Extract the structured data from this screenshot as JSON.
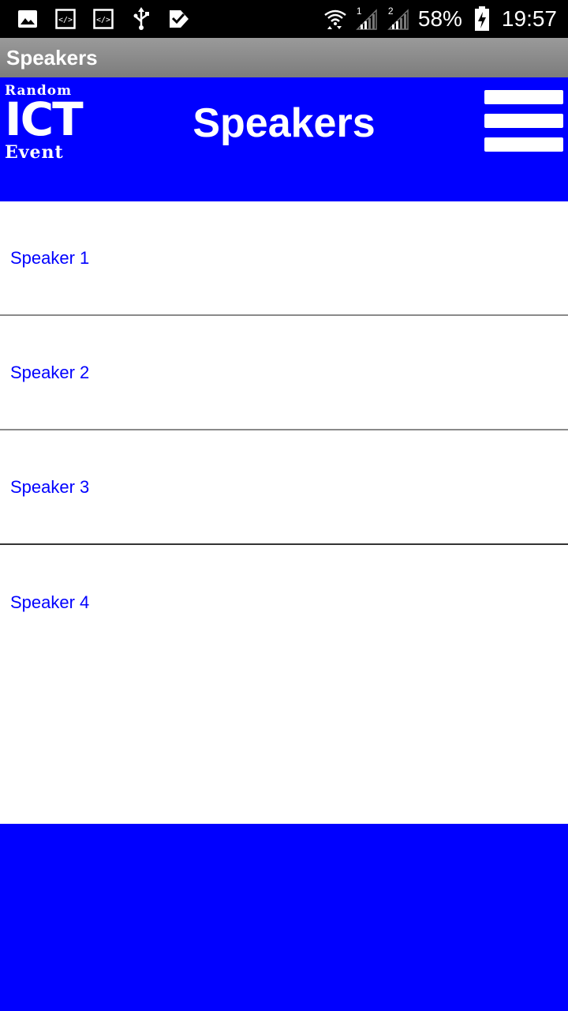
{
  "status_bar": {
    "battery_percent": "58%",
    "time": "19:57",
    "left_icons": [
      "gallery-icon",
      "code-icon",
      "code-icon",
      "usb-icon",
      "check-badge-icon"
    ],
    "right_icons": [
      "wifi-icon",
      "signal-sim1-icon",
      "signal-sim2-icon",
      "battery-charging-icon"
    ],
    "sim1_label": "1",
    "sim2_label": "2"
  },
  "action_bar": {
    "title": "Speakers"
  },
  "header": {
    "logo": {
      "line1": "Random",
      "line2": "ICT",
      "line3": "Event"
    },
    "title": "Speakers",
    "menu_icon": "hamburger-menu-icon"
  },
  "speakers": [
    {
      "label": "Speaker 1"
    },
    {
      "label": "Speaker 2"
    },
    {
      "label": "Speaker 3"
    },
    {
      "label": "Speaker 4"
    }
  ],
  "colors": {
    "brand_blue": "#0000ff",
    "status_bar": "#000000",
    "action_bar": "#8a8a8a",
    "link_text": "#0000ff",
    "divider": "#8a8a8a"
  }
}
